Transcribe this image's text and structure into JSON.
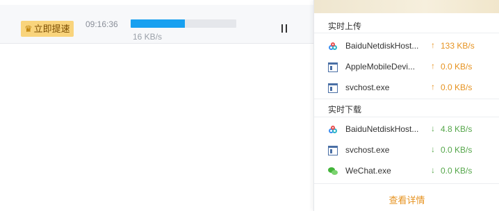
{
  "task": {
    "vip_label": "立即提速",
    "time": "09:16:36",
    "speed": "16 KB/s",
    "progress": 0.51
  },
  "panel": {
    "upload_title": "实时上传",
    "download_title": "实时下载",
    "details_label": "查看详情",
    "upload_items": [
      {
        "name": "BaiduNetdiskHost...",
        "arrow": "↑",
        "rate": "133 KB/s",
        "icon": "baidu-netdisk-icon"
      },
      {
        "name": "AppleMobileDevi...",
        "arrow": "↑",
        "rate": "0.0 KB/s",
        "icon": "window-icon"
      },
      {
        "name": "svchost.exe",
        "arrow": "↑",
        "rate": "0.0 KB/s",
        "icon": "window-icon"
      }
    ],
    "download_items": [
      {
        "name": "BaiduNetdiskHost...",
        "arrow": "↓",
        "rate": "4.8 KB/s",
        "icon": "baidu-netdisk-icon"
      },
      {
        "name": "svchost.exe",
        "arrow": "↓",
        "rate": "0.0 KB/s",
        "icon": "window-icon"
      },
      {
        "name": "WeChat.exe",
        "arrow": "↓",
        "rate": "0.0 KB/s",
        "icon": "wechat-icon"
      }
    ]
  },
  "colors": {
    "progress": "#18a0f0",
    "upload": "#e6921f",
    "download": "#55a64a",
    "vip": "#f9d47c"
  }
}
